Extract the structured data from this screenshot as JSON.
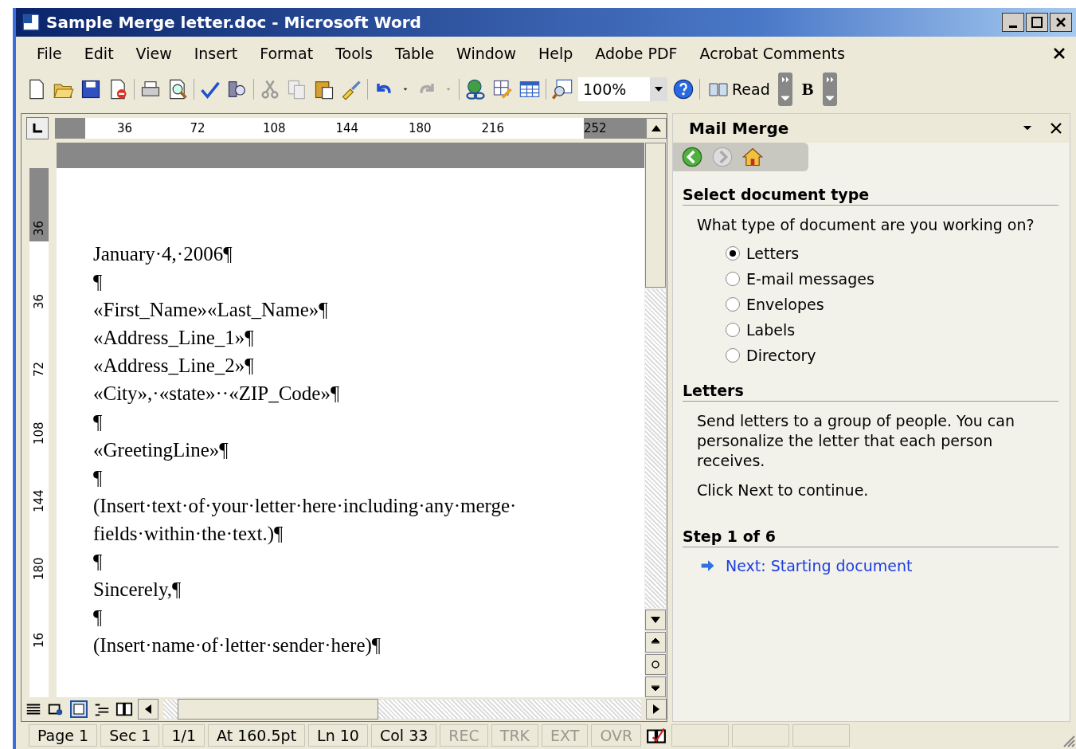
{
  "window": {
    "title": "Sample Merge letter.doc - Microsoft Word"
  },
  "menu": [
    "File",
    "Edit",
    "View",
    "Insert",
    "Format",
    "Tools",
    "Table",
    "Window",
    "Help",
    "Adobe PDF",
    "Acrobat Comments"
  ],
  "toolbar": {
    "zoom": "100%",
    "read": "Read",
    "bold": "B"
  },
  "ruler": {
    "horizontal": [
      "36",
      "72",
      "108",
      "144",
      "180",
      "216",
      "252"
    ],
    "vertical": [
      "36",
      "36",
      "72",
      "108",
      "144",
      "180",
      "16"
    ]
  },
  "document": {
    "paragraphs": [
      "January·4,·2006¶",
      "¶",
      "«First_Name»«Last_Name»¶",
      "«Address_Line_1»¶",
      "«Address_Line_2»¶",
      "«City»,·«state»··«ZIP_Code»¶",
      "¶",
      "«GreetingLine»¶",
      "¶",
      "(Insert·text·of·your·letter·here·including·any·merge·fields·within·the·text.)¶",
      "¶",
      "Sincerely,¶",
      "¶",
      "(Insert·name·of·letter·sender·here)¶"
    ]
  },
  "task_pane": {
    "title": "Mail Merge",
    "sections": [
      {
        "heading": "Select document type",
        "texts": [
          "What type of document are you working on?"
        ],
        "options": [
          {
            "label": "Letters",
            "selected": true
          },
          {
            "label": "E-mail messages",
            "selected": false
          },
          {
            "label": "Envelopes",
            "selected": false
          },
          {
            "label": "Labels",
            "selected": false
          },
          {
            "label": "Directory",
            "selected": false
          }
        ]
      },
      {
        "heading": "Letters",
        "texts": [
          "Send letters to a group of people. You can personalize the letter that each person receives.",
          "Click Next to continue."
        ]
      },
      {
        "heading": "Step 1 of 6",
        "link": "Next: Starting document"
      }
    ]
  },
  "status_bar": [
    {
      "text": "Page 1",
      "disabled": false
    },
    {
      "text": "Sec 1",
      "disabled": false
    },
    {
      "text": "1/1",
      "disabled": false
    },
    {
      "text": "At 160.5pt",
      "disabled": false
    },
    {
      "text": "Ln 10",
      "disabled": false
    },
    {
      "text": "Col 33",
      "disabled": false
    },
    {
      "text": "REC",
      "disabled": true
    },
    {
      "text": "TRK",
      "disabled": true
    },
    {
      "text": "EXT",
      "disabled": true
    },
    {
      "text": "OVR",
      "disabled": true
    }
  ]
}
